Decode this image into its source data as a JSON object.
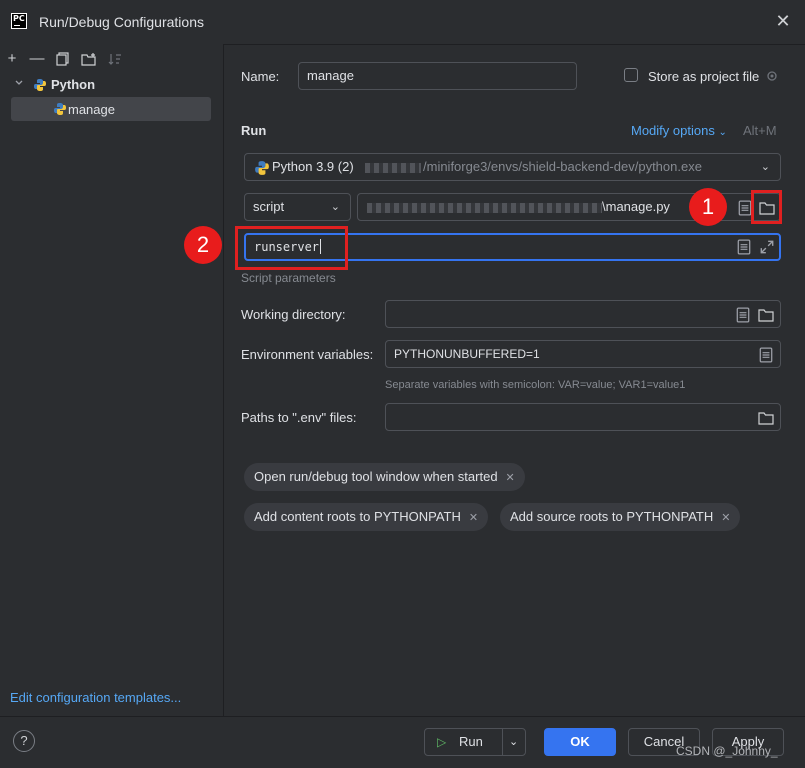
{
  "window": {
    "title": "Run/Debug Configurations"
  },
  "tree": {
    "group_label": "Python",
    "item_label": "manage"
  },
  "left_footer": {
    "edit_templates": "Edit configuration templates..."
  },
  "form": {
    "name_label": "Name:",
    "name_value": "manage",
    "store_label": "Store as project file",
    "run_section": "Run",
    "modify_options": "Modify options",
    "modify_shortcut": "Alt+M",
    "interpreter_name": "Python 3.9 (2)",
    "interpreter_path": "/miniforge3/envs/shield-backend-dev/python.exe",
    "script_type": "script",
    "script_path": "\\manage.py",
    "params_value": "runserver",
    "params_hint": "Script parameters",
    "workdir_label": "Working directory:",
    "workdir_value": "",
    "env_label": "Environment variables:",
    "env_value": "PYTHONUNBUFFERED=1",
    "env_hint": "Separate variables with semicolon: VAR=value; VAR1=value1",
    "dotenv_label": "Paths to \".env\" files:",
    "dotenv_value": ""
  },
  "chips": [
    "Open run/debug tool window when started",
    "Add content roots to PYTHONPATH",
    "Add source roots to PYTHONPATH"
  ],
  "footer": {
    "help": "?",
    "run": "Run",
    "ok": "OK",
    "cancel": "Cancel",
    "apply": "Apply"
  },
  "annotations": {
    "badge1": "1",
    "badge2": "2"
  },
  "watermark": "CSDN @_Johnny_",
  "colors": {
    "accent": "#3574f0",
    "link": "#56a8f5",
    "annotation_red": "#e02020"
  }
}
